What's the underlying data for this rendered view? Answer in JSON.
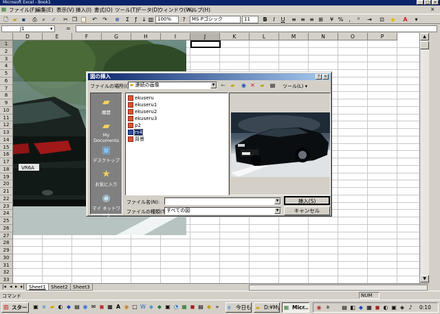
{
  "window": {
    "title": "Microsoft Excel - Book1"
  },
  "menu": [
    "ファイル(F)",
    "編集(E)",
    "表示(V)",
    "挿入(I)",
    "書式(O)",
    "ツール(T)",
    "データ(D)",
    "ウィンドウ(W)",
    "ヘルプ(H)"
  ],
  "toolbar": {
    "zoom": "100%",
    "font": "MS Pゴシック",
    "size": "11"
  },
  "formula": {
    "cell_ref": "J1"
  },
  "columns": [
    "D",
    "E",
    "F",
    "G",
    "H",
    "I",
    "J",
    "K",
    "L",
    "M",
    "N",
    "O",
    "P"
  ],
  "rows": [
    "1",
    "2",
    "3",
    "4",
    "5",
    "6",
    "7",
    "8",
    "9",
    "10",
    "11",
    "12",
    "13",
    "14",
    "15",
    "16",
    "17",
    "18",
    "19",
    "20",
    "21",
    "22",
    "23",
    "24",
    "25",
    "26",
    "27",
    "28",
    "29",
    "30",
    "31",
    "32",
    "33"
  ],
  "photo": {
    "plate": "VR6A"
  },
  "sheet_tabs": [
    "Sheet1",
    "Sheet2",
    "Sheet3"
  ],
  "status": {
    "left": "コマンド",
    "num": "NUM"
  },
  "dialog": {
    "title": "図の挿入",
    "location_label": "ファイルの場所(I):",
    "location_value": "連続の画像",
    "tools_label": "ツール(L) ▾",
    "places": [
      "履歴",
      "My Documents",
      "デスクトップ",
      "お気に入り",
      "マイ ネットワーク"
    ],
    "files": [
      "ekuseru",
      "ekuseru1",
      "ekuseru2",
      "ekuseru3",
      "p2",
      "rs4",
      "背景"
    ],
    "selected_file": "rs4",
    "filename_label": "ファイル名(N):",
    "filetype_label": "ファイルの種類(T):",
    "filetype_value": "すべての図",
    "insert_button": "挿入(S)",
    "cancel_button": "キャンセル"
  },
  "taskbar": {
    "start": "スタート",
    "buttons": [
      "今日も...",
      "D:¥My...",
      "Micr..."
    ],
    "clock": "0:10"
  },
  "colors": {
    "titlebar": "#0a246a",
    "selection": "#0a246a"
  }
}
